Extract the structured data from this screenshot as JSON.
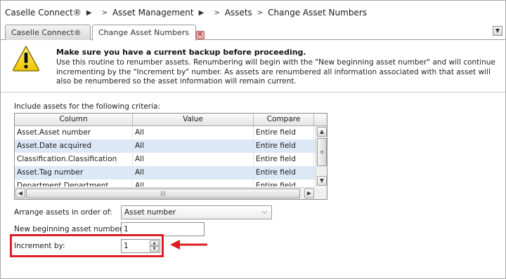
{
  "breadcrumb": {
    "items": [
      "Caselle Connect®",
      "Asset Management",
      "Assets",
      "Change Asset Numbers"
    ],
    "separator": ">"
  },
  "tabs": [
    {
      "label": "Caselle Connect®",
      "active": false
    },
    {
      "label": "Change Asset Numbers",
      "active": true,
      "closable": true
    }
  ],
  "warning": {
    "title": "Make sure you have a current backup before proceeding.",
    "body": "Use this routine to renumber assets. Renumbering will begin with the \"New beginning asset number\" and will continue incrementing by the \"Increment by\" number. As assets are renumbered all information associated with that asset will also be renumbered so the asset information will remain current.",
    "icon": "warning-triangle-icon"
  },
  "criteria": {
    "label": "Include assets for the following criteria:",
    "columns": [
      "Column",
      "Value",
      "Compare"
    ],
    "rows": [
      [
        "Asset.Asset number",
        "All",
        "Entire field"
      ],
      [
        "Asset.Date acquired",
        "All",
        "Entire field"
      ],
      [
        "Classification.Classification",
        "All",
        "Entire field"
      ],
      [
        "Asset.Tag number",
        "All",
        "Entire field"
      ],
      [
        "Department.Department",
        "All",
        "Entire field"
      ]
    ]
  },
  "form": {
    "order_label": "Arrange assets in order of:",
    "order_value": "Asset number",
    "start_label": "New beginning asset number:",
    "start_value": "1",
    "increment_label": "Increment by:",
    "increment_value": "1"
  },
  "colors": {
    "highlight": "#dd1c24",
    "alt_row": "#dde8f7",
    "warning_yellow": "#f5d21f"
  }
}
